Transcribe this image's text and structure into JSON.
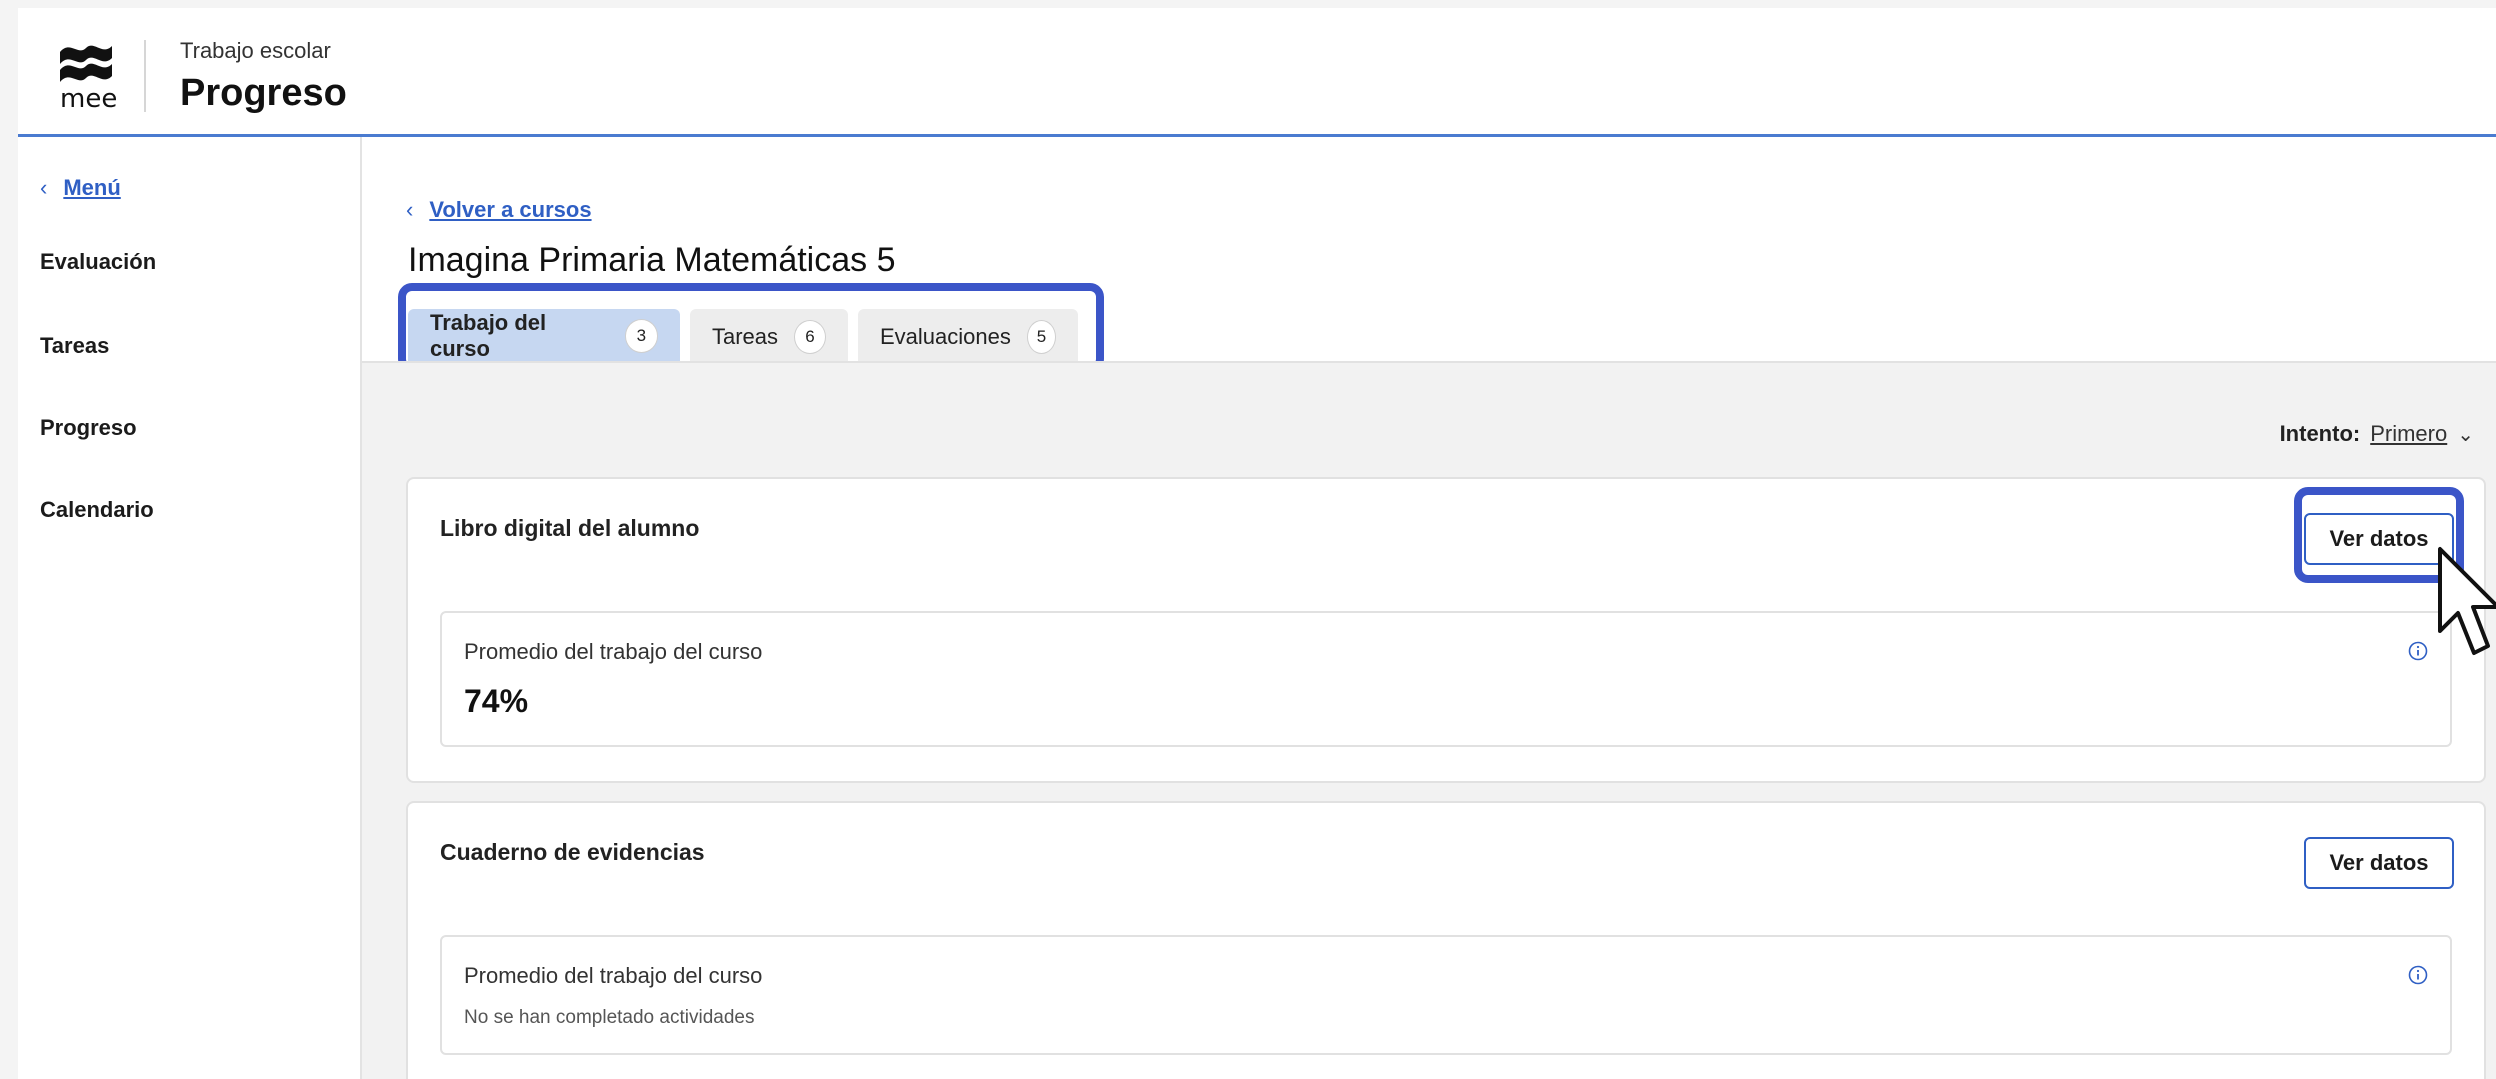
{
  "header": {
    "logo_text": "mee",
    "subtitle": "Trabajo escolar",
    "title": "Progreso"
  },
  "sidebar": {
    "menu_label": "Menú",
    "items": [
      {
        "label": "Evaluación"
      },
      {
        "label": "Tareas"
      },
      {
        "label": "Progreso"
      },
      {
        "label": "Calendario"
      }
    ]
  },
  "main": {
    "back_label": "Volver a cursos",
    "course_title": "Imagina Primaria Matemáticas 5",
    "tabs": [
      {
        "label": "Trabajo del curso",
        "count": "3",
        "active": true
      },
      {
        "label": "Tareas",
        "count": "6",
        "active": false
      },
      {
        "label": "Evaluaciones",
        "count": "5",
        "active": false
      }
    ],
    "attempt_label": "Intento:",
    "attempt_value": "Primero",
    "cards": [
      {
        "title": "Libro digital del alumno",
        "button": "Ver datos",
        "metric_label": "Promedio del trabajo del curso",
        "metric_value": "74%"
      },
      {
        "title": "Cuaderno de evidencias",
        "button": "Ver datos",
        "metric_label": "Promedio del trabajo del curso",
        "metric_note": "No se han completado actividades"
      }
    ]
  },
  "colors": {
    "accent": "#2f5fc4",
    "highlight_outline": "#3b55c8",
    "active_tab": "#c6d7f1",
    "background": "#f2f2f2"
  },
  "icons": {
    "logo": "mee-waves-logo",
    "back": "chevron-left-icon",
    "attempt": "chevron-down-icon",
    "info": "info-circle-icon",
    "cursor": "mouse-pointer-icon"
  }
}
